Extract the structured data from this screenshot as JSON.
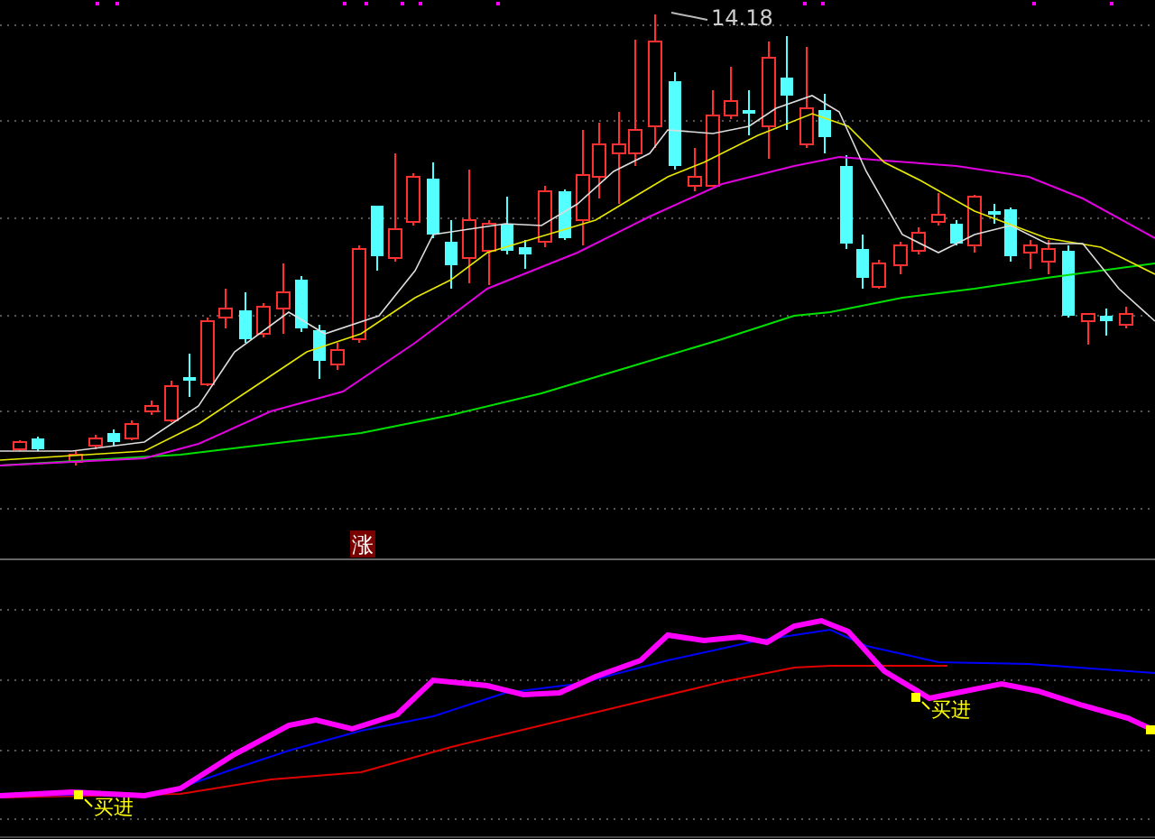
{
  "price_panel": {
    "high_label": "14.18",
    "signal_badge": "涨"
  },
  "indicator_panel": {
    "signals": [
      {
        "label": "买进"
      },
      {
        "label": "买进"
      }
    ]
  }
}
